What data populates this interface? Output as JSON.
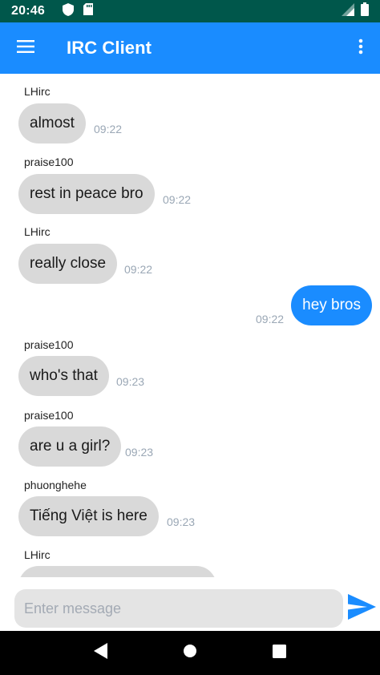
{
  "status_bar": {
    "time": "20:46"
  },
  "app_bar": {
    "title": "IRC Client"
  },
  "messages": [
    {
      "sender": "LHirc",
      "text": "almost",
      "time": "09:22",
      "outgoing": false
    },
    {
      "sender": "praise100",
      "text": "rest in peace bro",
      "time": "09:22",
      "outgoing": false
    },
    {
      "sender": "LHirc",
      "text": "really close",
      "time": "09:22",
      "outgoing": false
    },
    {
      "sender": "",
      "text": "hey bros",
      "time": "09:22",
      "outgoing": true
    },
    {
      "sender": "praise100",
      "text": "who's that",
      "time": "09:23",
      "outgoing": false
    },
    {
      "sender": "praise100",
      "text": "are u a girl?",
      "time": "09:23",
      "outgoing": false
    },
    {
      "sender": "phuonghehe",
      "text": "Tiếng Việt is here",
      "time": "09:23",
      "outgoing": false
    },
    {
      "sender": "LHirc",
      "text": "",
      "time": "",
      "outgoing": false
    }
  ],
  "composer": {
    "placeholder": "Enter message",
    "value": ""
  },
  "colors": {
    "status_bar": "#00574b",
    "app_bar": "#1a8cff",
    "bubble_in": "#d9d9d9",
    "bubble_out": "#1a8cff",
    "timestamp": "#9aa7b5"
  },
  "icons": {
    "menu": "hamburger-menu-icon",
    "more": "more-vert-icon",
    "send": "send-icon"
  }
}
